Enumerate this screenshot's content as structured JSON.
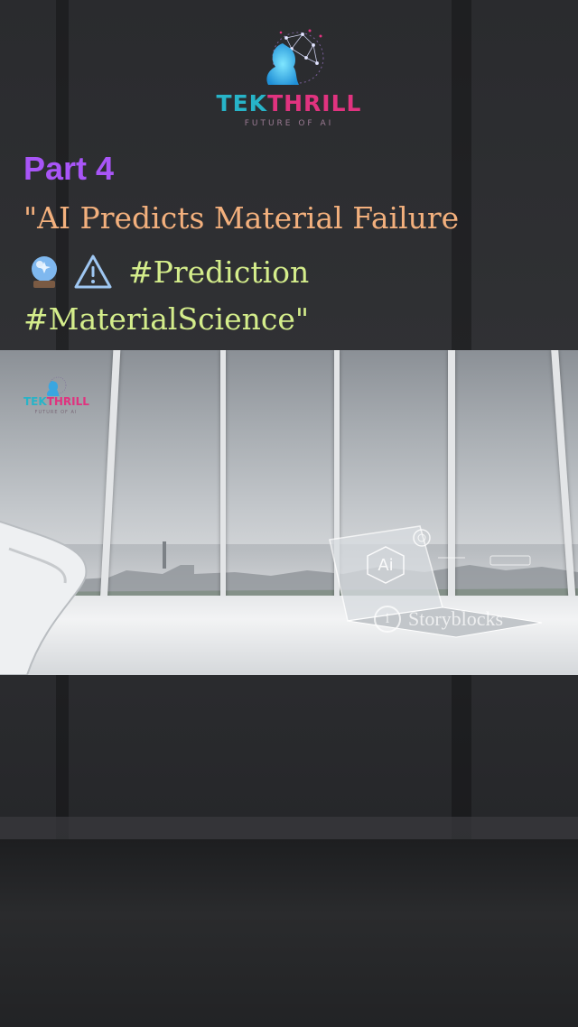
{
  "logo": {
    "brand_tek": "TEK",
    "brand_thrill": "THRILL",
    "tagline": "FUTURE OF AI"
  },
  "caption": {
    "part": "Part 4",
    "title": "\"AI Predicts Material Failure",
    "hashtag_1": "#Prediction",
    "hashtag_2": "#MaterialScience\"",
    "emoji_1": "crystal-ball-icon",
    "emoji_2": "warning-icon"
  },
  "video": {
    "watermark_logo": {
      "brand_tek": "TEK",
      "brand_thrill": "THRILL",
      "tagline": "FUTURE OF AI"
    },
    "laptop_screen_text": "Ai",
    "stock_watermark": "Storyblocks"
  },
  "colors": {
    "part": "#a855f7",
    "title": "#f3b07d",
    "hashtags": "#d4ed8b",
    "brand_cyan": "#27b4c8",
    "brand_pink": "#e0337f"
  }
}
